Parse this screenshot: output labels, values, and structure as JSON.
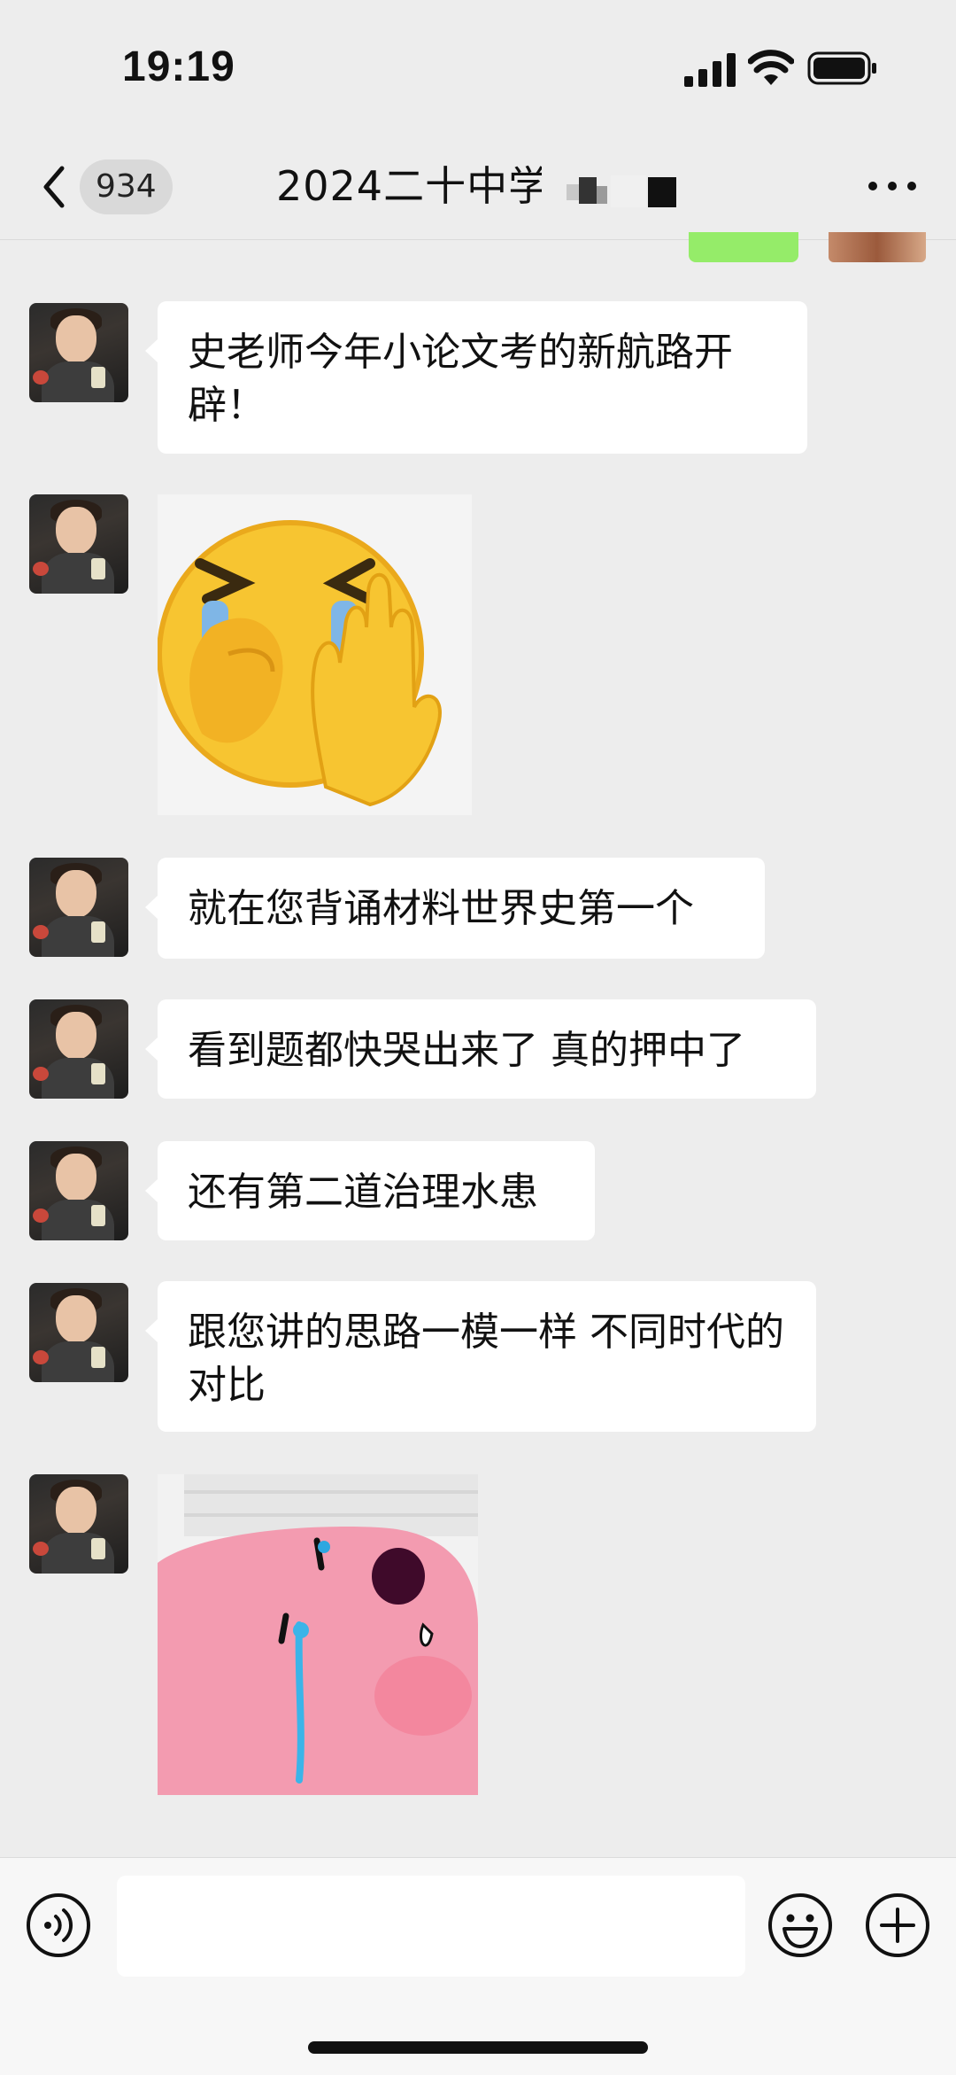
{
  "status_bar": {
    "time": "19:19"
  },
  "nav": {
    "unread_count": "934",
    "title": "2024二十中学"
  },
  "messages": [
    {
      "type": "text",
      "text": "史老师今年小论文考的新航路开辟！"
    },
    {
      "type": "sticker",
      "sticker": "crying-emoji-hand-sticker"
    },
    {
      "type": "text",
      "text": "就在您背诵材料世界史第一个"
    },
    {
      "type": "text",
      "text": "看到题都快哭出来了 真的押中了"
    },
    {
      "type": "text",
      "text": "还有第二道治理水患"
    },
    {
      "type": "text",
      "text": "跟您讲的思路一模一样 不同时代的对比"
    },
    {
      "type": "sticker",
      "sticker": "crying-pink-blob-sticker"
    }
  ],
  "icons": {
    "back": "chevron-left-icon",
    "more": "more-dots-icon",
    "voice": "voice-icon",
    "emoji": "emoji-icon",
    "plus": "plus-icon"
  },
  "colors": {
    "background": "#ededed",
    "bubble": "#ffffff",
    "self_bubble": "#95ec69",
    "input_bar": "#f7f7f7"
  }
}
